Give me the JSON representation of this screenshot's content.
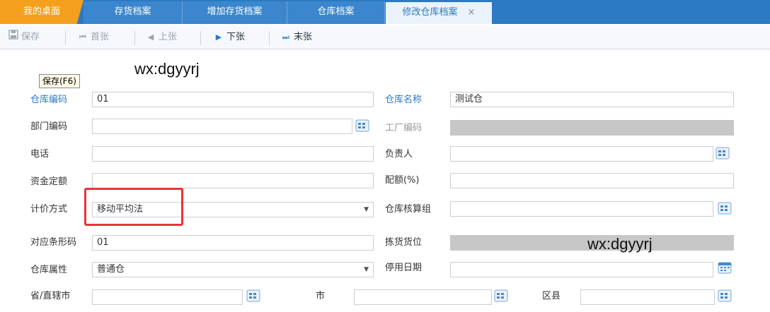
{
  "tabs": [
    {
      "label": "我的桌面"
    },
    {
      "label": "存货档案"
    },
    {
      "label": "增加存货档案"
    },
    {
      "label": "仓库档案"
    },
    {
      "label": "修改仓库档案",
      "close": "×"
    }
  ],
  "toolbar": {
    "save": "保存",
    "first": "首张",
    "prev": "上张",
    "next": "下张",
    "last": "末张"
  },
  "tooltip": "保存(F6)",
  "watermark": "wx:dgyyrj",
  "form": {
    "warehouse_code": {
      "label": "仓库编码",
      "value": "01"
    },
    "warehouse_name": {
      "label": "仓库名称",
      "value": "测试仓"
    },
    "dept_code": {
      "label": "部门编码",
      "value": ""
    },
    "factory_code": {
      "label": "工厂编码",
      "value": ""
    },
    "phone": {
      "label": "电话",
      "value": ""
    },
    "manager": {
      "label": "负责人",
      "value": ""
    },
    "fund_quota": {
      "label": "资金定额",
      "value": ""
    },
    "quota_pct": {
      "label": "配额(%)",
      "value": ""
    },
    "pricing_method": {
      "label": "计价方式",
      "value": "移动平均法"
    },
    "accounting_group": {
      "label": "仓库核算组",
      "value": ""
    },
    "barcode": {
      "label": "对应条形码",
      "value": "01"
    },
    "picking_location": {
      "label": "拣货货位",
      "value": ""
    },
    "attribute": {
      "label": "仓库属性",
      "value": "普通仓"
    },
    "disable_date": {
      "label": "停用日期",
      "value": ""
    },
    "province": {
      "label": "省/直辖市",
      "value": ""
    },
    "city": {
      "label": "市",
      "value": ""
    },
    "district": {
      "label": "区县",
      "value": ""
    }
  },
  "colors": {
    "tab_bar": "#2c7ac3",
    "home_tab": "#f4a01e",
    "required_label": "#2c7ac3",
    "highlight": "#e8343a"
  }
}
